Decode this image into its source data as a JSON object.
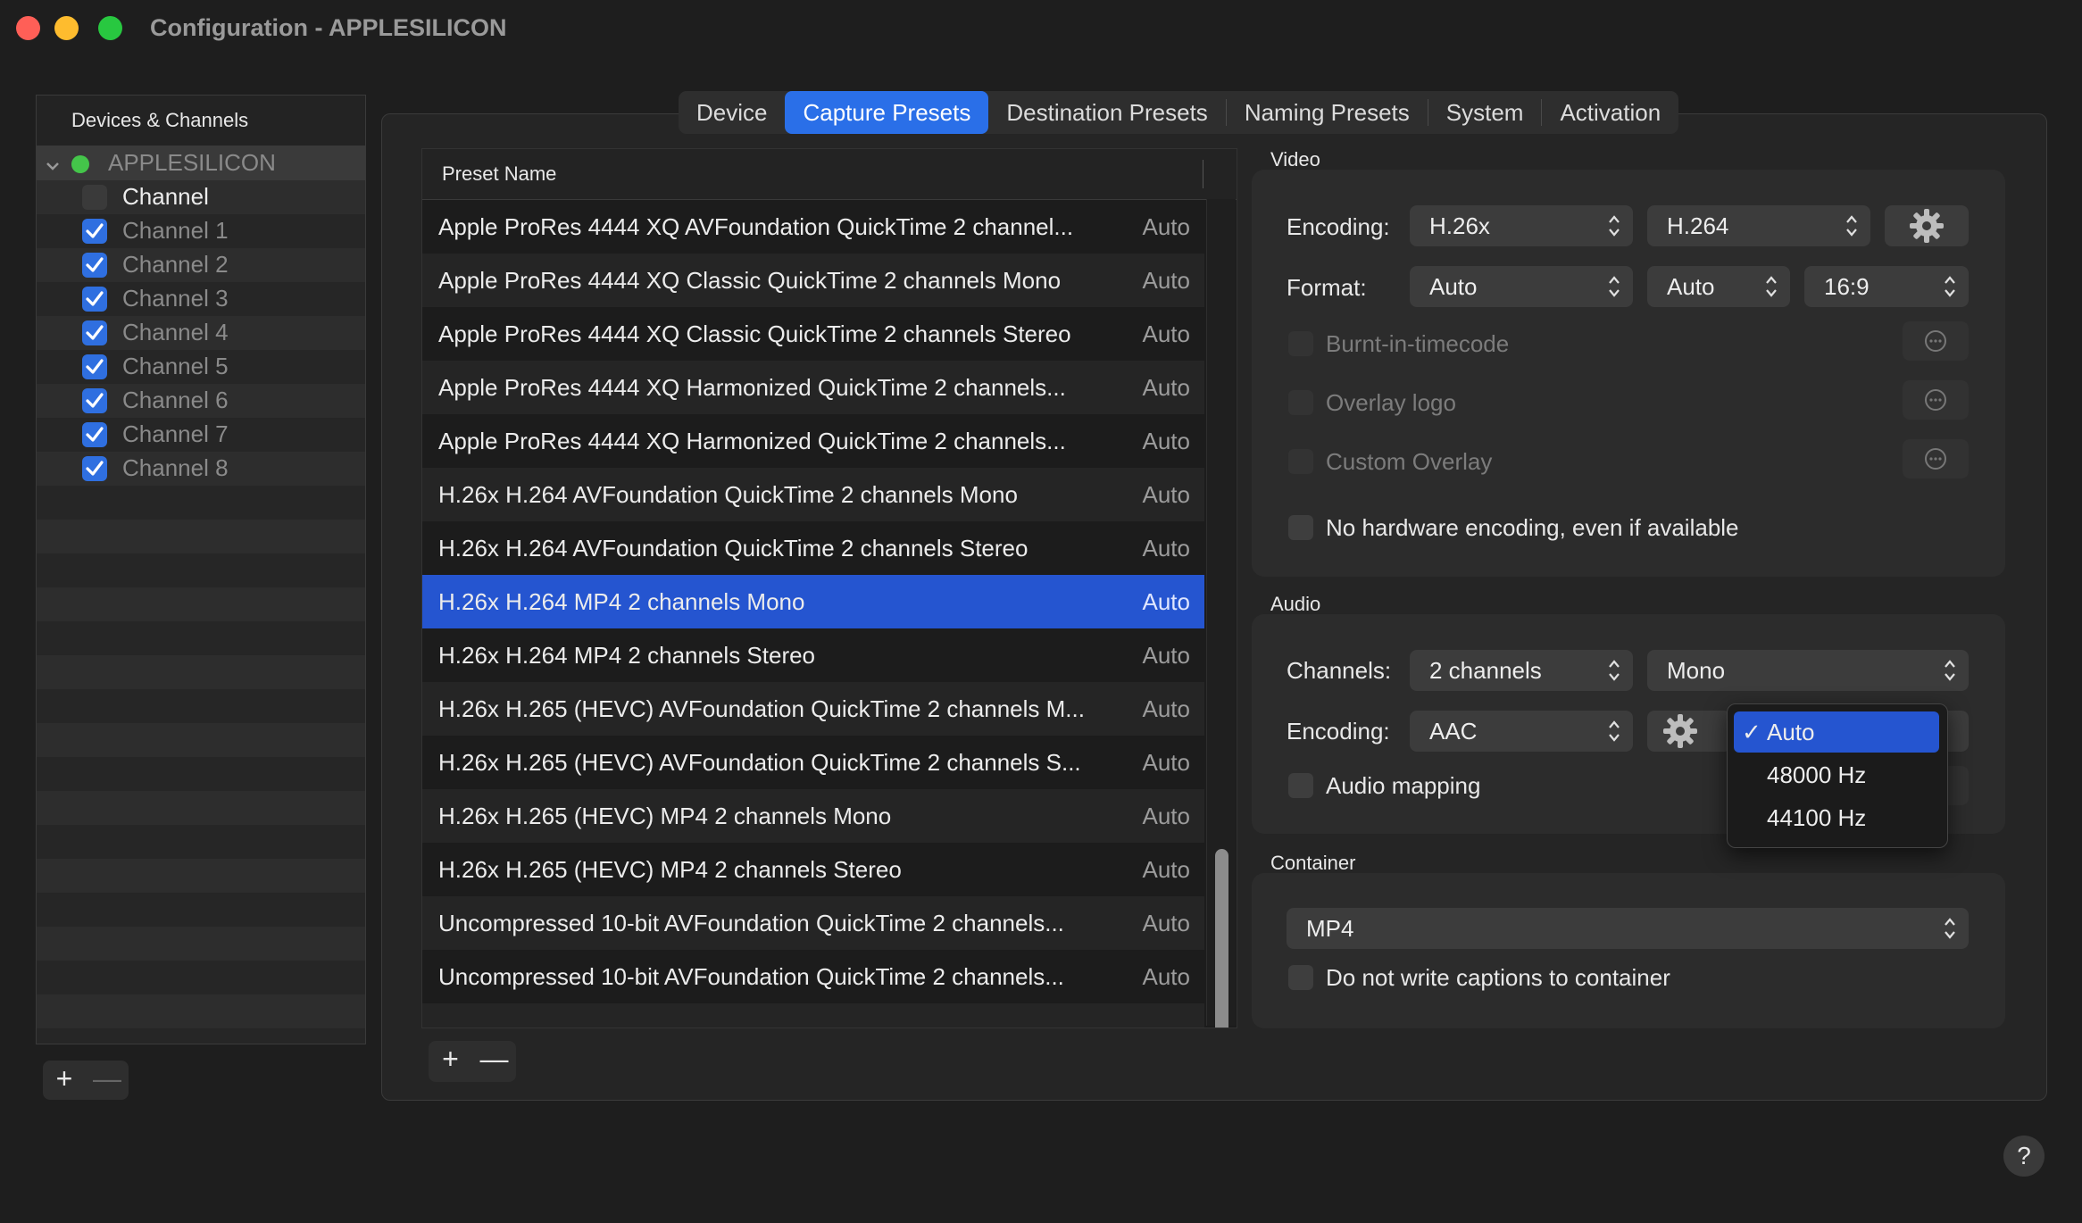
{
  "window": {
    "title": "Configuration - APPLESILICON",
    "colors": {
      "close": "#ff5f57",
      "minimize": "#febc2e",
      "zoom": "#28c840",
      "accent": "#2a6fe8"
    }
  },
  "sidebar": {
    "header": "Devices & Channels",
    "device": {
      "name": "APPLESILICON",
      "status_color": "#44c54a"
    },
    "items": [
      {
        "label": "Channel",
        "checked": false
      },
      {
        "label": "Channel 1",
        "checked": true
      },
      {
        "label": "Channel 2",
        "checked": true
      },
      {
        "label": "Channel 3",
        "checked": true
      },
      {
        "label": "Channel 4",
        "checked": true
      },
      {
        "label": "Channel 5",
        "checked": true
      },
      {
        "label": "Channel 6",
        "checked": true
      },
      {
        "label": "Channel 7",
        "checked": true
      },
      {
        "label": "Channel 8",
        "checked": true
      }
    ],
    "add_label": "+",
    "remove_label": "—"
  },
  "tabs": [
    {
      "label": "Device"
    },
    {
      "label": "Capture Presets",
      "active": true
    },
    {
      "label": "Destination Presets"
    },
    {
      "label": "Naming Presets"
    },
    {
      "label": "System"
    },
    {
      "label": "Activation"
    }
  ],
  "presets": {
    "header": "Preset Name",
    "rows": [
      {
        "name": "Apple ProRes 4444 XQ AVFoundation QuickTime 2 channel...",
        "value": "Auto"
      },
      {
        "name": "Apple ProRes 4444 XQ Classic QuickTime 2 channels Mono",
        "value": "Auto"
      },
      {
        "name": "Apple ProRes 4444 XQ Classic QuickTime 2 channels Stereo",
        "value": "Auto"
      },
      {
        "name": "Apple ProRes 4444 XQ Harmonized QuickTime 2 channels...",
        "value": "Auto"
      },
      {
        "name": "Apple ProRes 4444 XQ Harmonized QuickTime 2 channels...",
        "value": "Auto"
      },
      {
        "name": "H.26x H.264 AVFoundation QuickTime 2 channels Mono",
        "value": "Auto"
      },
      {
        "name": "H.26x H.264 AVFoundation QuickTime 2 channels Stereo",
        "value": "Auto"
      },
      {
        "name": "H.26x H.264 MP4 2 channels Mono",
        "value": "Auto",
        "selected": true
      },
      {
        "name": "H.26x H.264 MP4 2 channels Stereo",
        "value": "Auto"
      },
      {
        "name": "H.26x H.265 (HEVC) AVFoundation QuickTime 2 channels M...",
        "value": "Auto"
      },
      {
        "name": "H.26x H.265 (HEVC) AVFoundation QuickTime 2 channels S...",
        "value": "Auto"
      },
      {
        "name": "H.26x H.265 (HEVC) MP4 2 channels Mono",
        "value": "Auto"
      },
      {
        "name": "H.26x H.265 (HEVC) MP4 2 channels Stereo",
        "value": "Auto"
      },
      {
        "name": "Uncompressed 10-bit AVFoundation QuickTime 2 channels...",
        "value": "Auto"
      },
      {
        "name": "Uncompressed 10-bit AVFoundation QuickTime 2 channels...",
        "value": "Auto"
      }
    ],
    "add_label": "+",
    "remove_label": "—"
  },
  "video": {
    "section_label": "Video",
    "encoding_label": "Encoding:",
    "encoding_family": "H.26x",
    "encoding_codec": "H.264",
    "format_label": "Format:",
    "format_1": "Auto",
    "format_2": "Auto",
    "format_3": "16:9",
    "burnt_in": "Burnt-in-timecode",
    "overlay_logo": "Overlay logo",
    "custom_overlay": "Custom Overlay",
    "no_hw": "No hardware encoding, even if available"
  },
  "audio": {
    "section_label": "Audio",
    "channels_label": "Channels:",
    "channels_value": "2 channels",
    "mode_value": "Mono",
    "encoding_label": "Encoding:",
    "encoding_value": "AAC",
    "mapping_label": "Audio mapping"
  },
  "sample_rate_menu": {
    "options": [
      "Auto",
      "48000 Hz",
      "44100 Hz"
    ],
    "selected": "Auto"
  },
  "container": {
    "section_label": "Container",
    "value": "MP4",
    "no_captions": "Do not write captions to container"
  },
  "help_label": "?"
}
